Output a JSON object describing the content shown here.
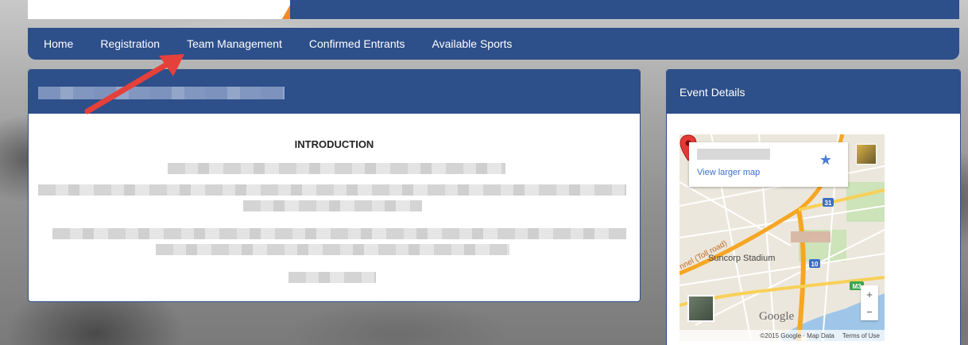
{
  "nav": {
    "items": [
      "Home",
      "Registration",
      "Team Management",
      "Confirmed Entrants",
      "Available Sports"
    ]
  },
  "main": {
    "intro_title": "INTRODUCTION"
  },
  "side": {
    "title": "Event Details",
    "map": {
      "view_larger": "View larger map",
      "stadium": "Suncorp Stadium",
      "google": "Google",
      "copyright": "©2015 Google · Map Data",
      "terms": "Terms of Use",
      "road_label": "nnel (Toll road)",
      "route_31": "31",
      "route_10": "10",
      "route_m3": "M3",
      "zoom_in": "+",
      "zoom_out": "−",
      "star": "★"
    }
  },
  "colors": {
    "nav_blue": "#2d4f8a",
    "annotation_red": "#e5403a",
    "accent_orange": "#f08a24"
  }
}
